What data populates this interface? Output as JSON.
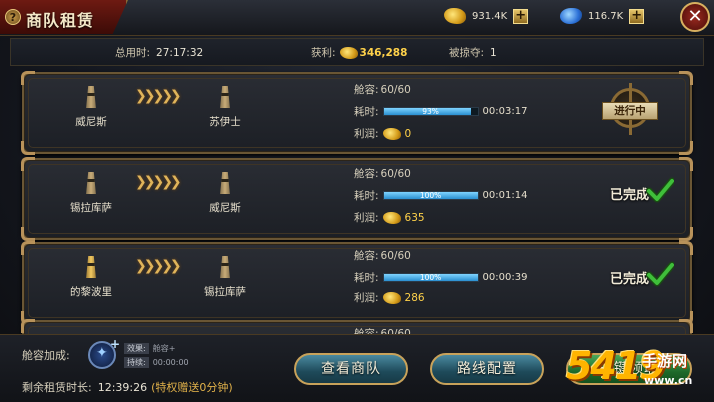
{
  "header": {
    "help_icon": "?",
    "title": "商队租赁",
    "gold_amount": "931.4K",
    "gem_amount": "116.7K",
    "plus_label": "+",
    "close_label": "✕"
  },
  "stats": {
    "total_time_label": "总用时:",
    "total_time_value": "27:17:32",
    "profit_label": "获利:",
    "profit_value": "346,288",
    "plunder_label": "被掠夺:",
    "plunder_value": "1"
  },
  "routes": [
    {
      "from": "威尼斯",
      "to": "苏伊士",
      "capacity_label": "舱容:",
      "capacity": "60/60",
      "time_label": "耗时:",
      "progress_text": "93%",
      "progress": 0.93,
      "remaining": "00:03:17",
      "profit_label": "利润:",
      "profit": "0",
      "status": "进行中"
    },
    {
      "from": "锡拉库萨",
      "to": "威尼斯",
      "capacity_label": "舱容:",
      "capacity": "60/60",
      "time_label": "耗时:",
      "progress_text": "100%",
      "progress": 1.0,
      "remaining": "00:01:14",
      "profit_label": "利润:",
      "profit": "635",
      "status": "已完成"
    },
    {
      "from": "的黎波里",
      "to": "锡拉库萨",
      "capacity_label": "舱容:",
      "capacity": "60/60",
      "time_label": "耗时:",
      "progress_text": "100%",
      "progress": 1.0,
      "remaining": "00:00:39",
      "profit_label": "利润:",
      "profit": "286",
      "status": "已完成"
    },
    {
      "capacity_label": "舱容:",
      "capacity": "60/60"
    }
  ],
  "route_arrows": "❯❯❯❯❯",
  "bottom": {
    "bonus_label": "舱容加成:",
    "effect_key": "效果:",
    "effect_value": "舱容+",
    "duration_key": "持续:",
    "duration_value": "00:00:00",
    "remaining_label": "剩余租赁时长:",
    "remaining_value": "12:39:26",
    "remaining_note": "(特权赠送0分钟)",
    "view_fleet_button": "查看商队",
    "route_config_button": "路线配置",
    "third_button": "一键领取"
  },
  "watermark": {
    "number": "54",
    "glyph": "19",
    "site_name": "手游网",
    "site_url": "www.cn"
  },
  "colors": {
    "accent_gold": "#ffd24a",
    "frame": "#6a5634",
    "progress": "#2a8fd0",
    "complete_check": "#3fbf3a"
  },
  "icons": {
    "gold": "gold-coins-icon",
    "gem": "blue-gem-icon",
    "city": "lighthouse-icon",
    "done": "checkmark-icon",
    "in_progress": "ship-wheel-icon"
  }
}
